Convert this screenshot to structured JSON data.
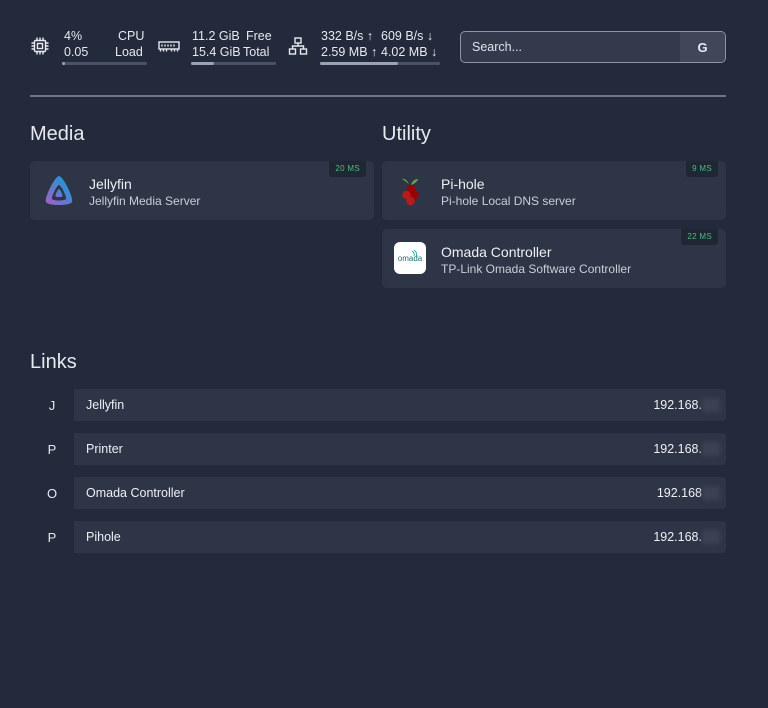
{
  "widgets": {
    "cpu": {
      "percent": "4%",
      "percent_label": "CPU",
      "load": "0.05",
      "load_label": "Load",
      "usage": 0.04,
      "icon": "cpu-icon"
    },
    "memory": {
      "free": "11.2 GiB",
      "free_label": "Free",
      "total": "15.4 GiB",
      "total_label": "Total",
      "usage": 0.27,
      "icon": "memory-icon"
    },
    "network": {
      "up_rate": "332 B/s ↑",
      "down_rate": "609 B/s ↓",
      "up_total": "2.59 MB ↑",
      "down_total": "4.02 MB ↓",
      "usage": 0.65,
      "icon": "network-icon"
    }
  },
  "search": {
    "placeholder": "Search...",
    "button": "G",
    "icon": "google-icon"
  },
  "groups": [
    {
      "title": "Media",
      "services": [
        {
          "name": "Jellyfin",
          "description": "Jellyfin Media Server",
          "ping": "20 MS",
          "icon": "jellyfin-icon"
        }
      ]
    },
    {
      "title": "Utility",
      "services": [
        {
          "name": "Pi-hole",
          "description": "Pi-hole Local DNS server",
          "ping": "9 MS",
          "icon": "pihole-icon"
        },
        {
          "name": "Omada Controller",
          "description": "TP-Link Omada Software Controller",
          "ping": "22 MS",
          "icon": "omada-icon",
          "icon_text": "omada"
        }
      ]
    }
  ],
  "links": {
    "title": "Links",
    "items": [
      {
        "letter": "J",
        "name": "Jellyfin",
        "url": "192.168."
      },
      {
        "letter": "P",
        "name": "Printer",
        "url": "192.168."
      },
      {
        "letter": "O",
        "name": "Omada Controller",
        "url": "192.168"
      },
      {
        "letter": "P",
        "name": "Pihole",
        "url": "192.168."
      }
    ]
  },
  "colors": {
    "background": "#232a3b",
    "card": "#2e3547",
    "ping": "#51b97e"
  }
}
